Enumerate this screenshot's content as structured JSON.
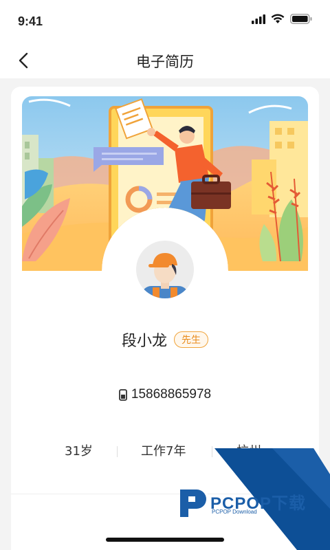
{
  "status_bar": {
    "time": "9:41"
  },
  "nav": {
    "title": "电子简历"
  },
  "profile": {
    "name": "段小龙",
    "gender_badge": "先生",
    "phone": "15868865978",
    "age": "31岁",
    "experience": "工作7年",
    "city": "杭州"
  },
  "watermark": {
    "brand": "PCPOP下载",
    "sub": "PCPOP Download"
  },
  "colors": {
    "accent_orange": "#f0a33a",
    "brand_blue": "#0d4f96"
  },
  "icons": [
    "signal-icon",
    "wifi-icon",
    "battery-icon",
    "back-arrow-icon",
    "phone-icon"
  ]
}
